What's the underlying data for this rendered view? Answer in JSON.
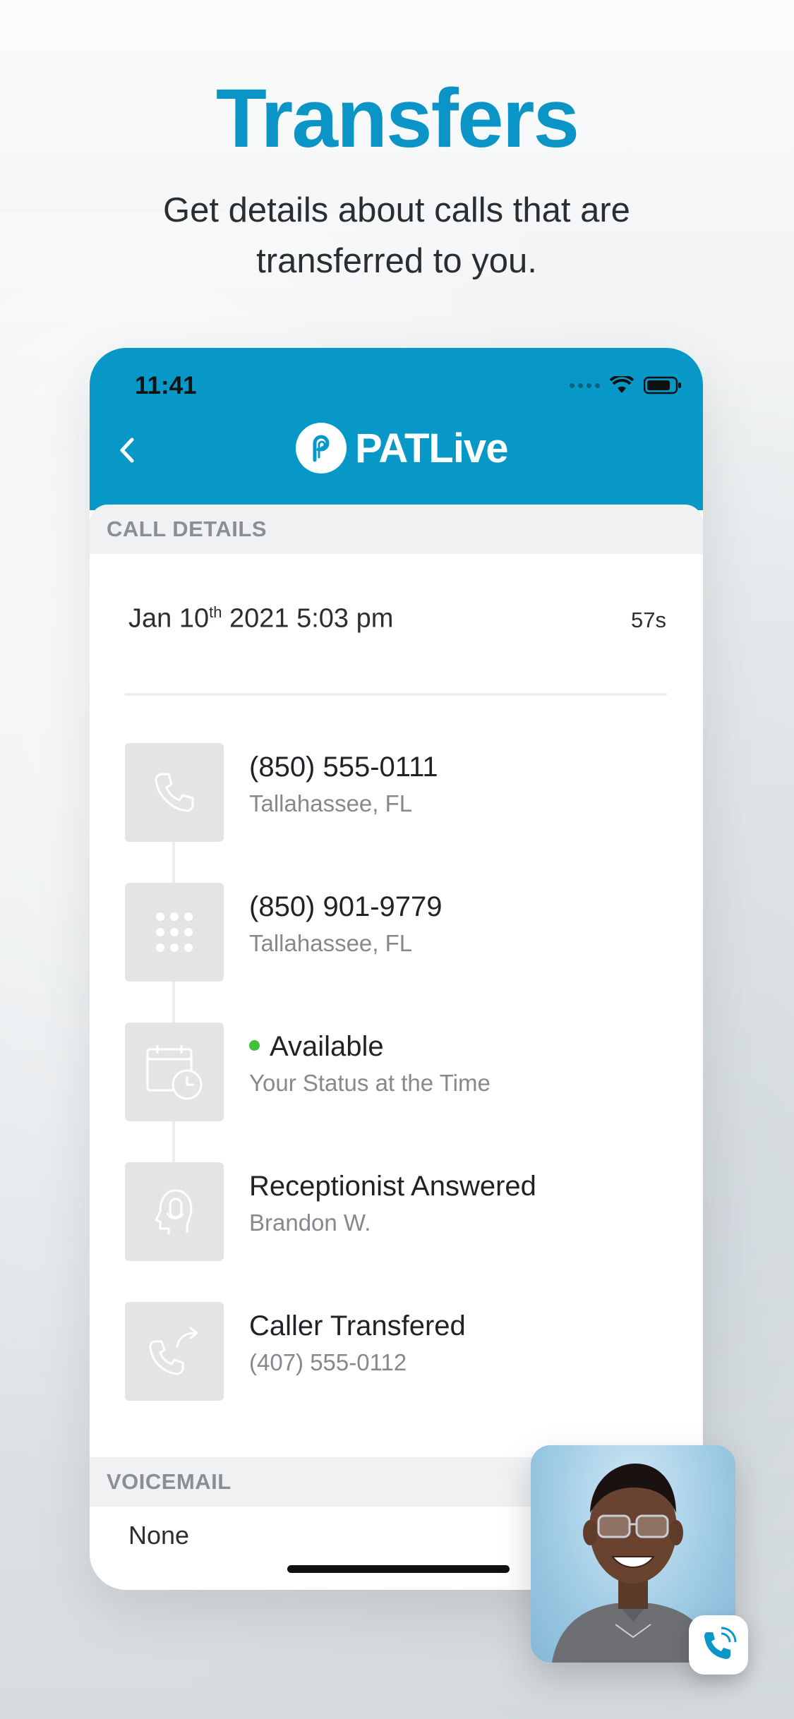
{
  "marketing": {
    "headline": "Transfers",
    "subline": "Get details about calls that are transferred to you."
  },
  "status_bar": {
    "time": "11:41"
  },
  "header": {
    "brand_name": "PATLive"
  },
  "call_details": {
    "section_label": "CALL DETAILS",
    "date_prefix": "Jan 10",
    "date_suffix": "th",
    "date_rest": " 2021 5:03 pm",
    "duration": "57s",
    "rows": [
      {
        "icon": "phone-icon",
        "title": "(850) 555-0111",
        "subtitle": "Tallahassee, FL"
      },
      {
        "icon": "dialpad-icon",
        "title": "(850) 901-9779",
        "subtitle": "Tallahassee, FL"
      },
      {
        "icon": "calendar-clock-icon",
        "title": "Available",
        "subtitle": "Your Status at the Time"
      },
      {
        "icon": "headset-icon",
        "title": "Receptionist Answered",
        "subtitle": "Brandon W."
      },
      {
        "icon": "call-transfer-icon",
        "title": "Caller Transfered",
        "subtitle": "(407) 555-0112"
      }
    ]
  },
  "voicemail": {
    "section_label": "VOICEMAIL",
    "value": "None"
  },
  "colors": {
    "brand": "#0898c8",
    "headline": "#0a95c6",
    "available": "#41c136"
  }
}
